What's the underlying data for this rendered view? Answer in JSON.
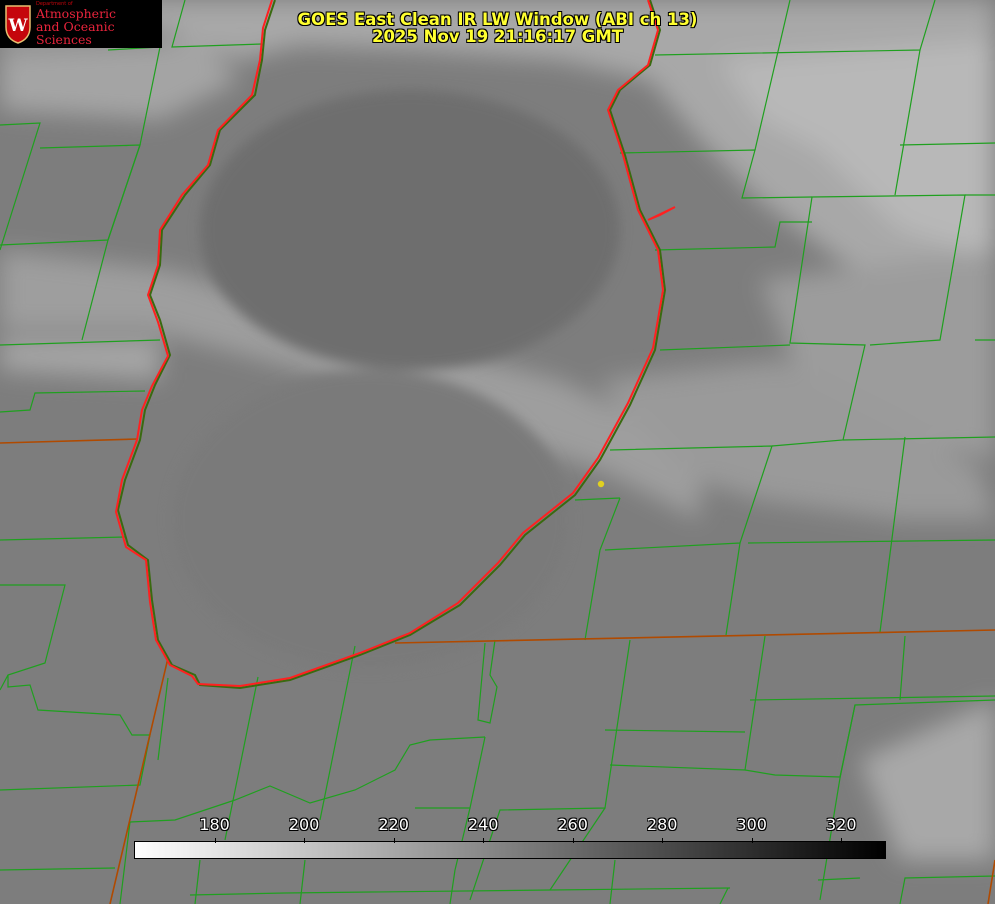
{
  "header": {
    "title_line1": "GOES East Clean IR LW Window (ABI ch 13)",
    "title_line2": "2025 Nov 19 21:16:17 GMT"
  },
  "logo": {
    "department": "Department of",
    "line1": "Atmospheric",
    "line2": "and Oceanic Sciences",
    "crest_letter": "W"
  },
  "colorbar": {
    "ticks": [
      180,
      200,
      220,
      240,
      260,
      280,
      300,
      320
    ],
    "range": [
      162,
      330
    ],
    "gradient_start": "#ffffff",
    "gradient_end": "#000000"
  },
  "colors": {
    "title_text": "#ffff30",
    "county_lines": "#1fa01f",
    "state_lines": "#b04a00",
    "lake_outline": "#ff2020",
    "marker": "#e0d020"
  },
  "icons": {
    "crest": "uw-crest-icon",
    "marker": "location-dot-icon"
  }
}
